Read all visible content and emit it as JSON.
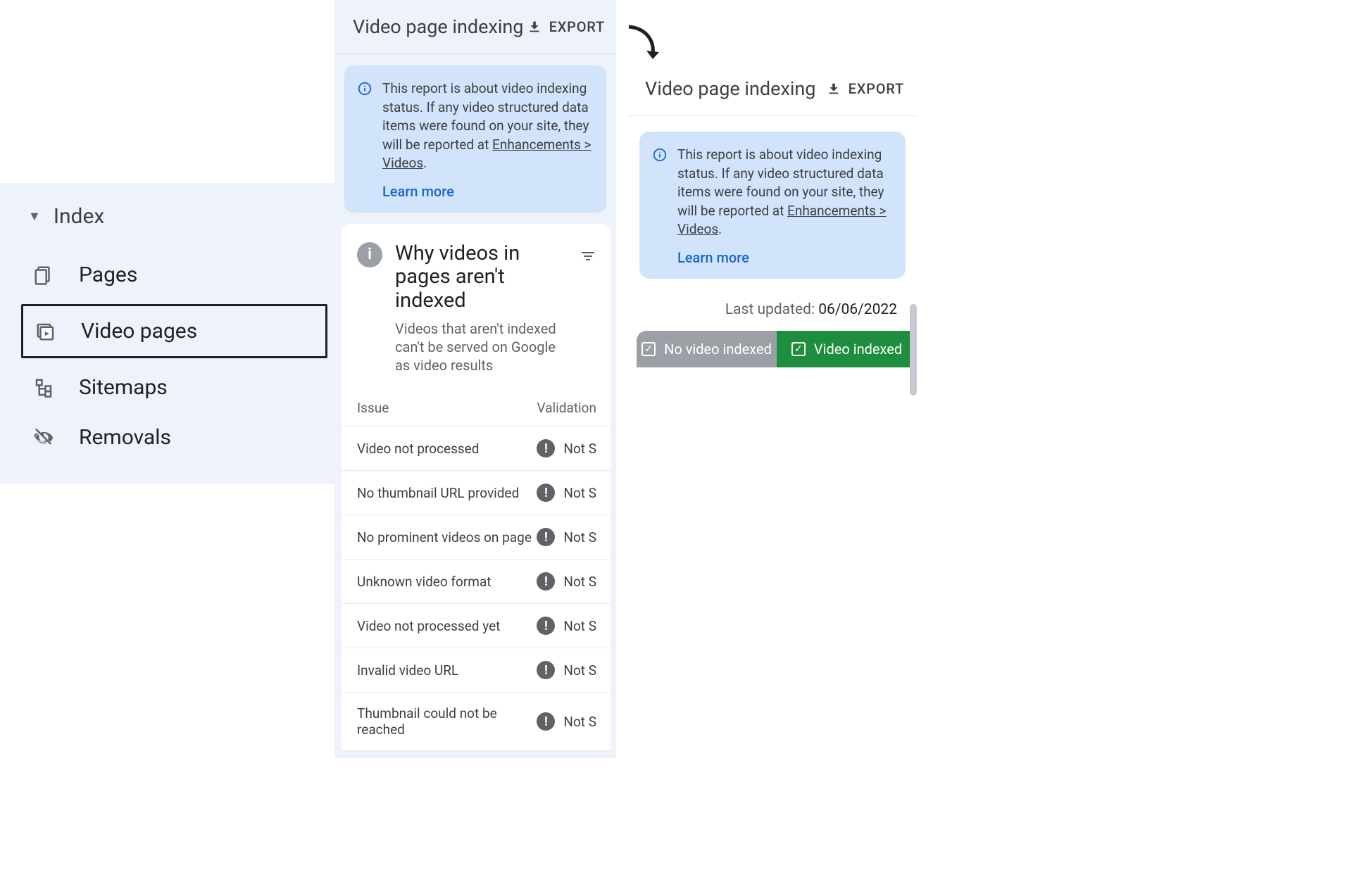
{
  "sidebar": {
    "group_label": "Index",
    "items": [
      {
        "label": "Pages"
      },
      {
        "label": "Video pages"
      },
      {
        "label": "Sitemaps"
      },
      {
        "label": "Removals"
      }
    ]
  },
  "mid": {
    "title": "Video page indexing",
    "export_label": "EXPORT",
    "info_text_a": "This report is about video indexing status. If any video structured data items were found on your site, they will be reported at ",
    "info_link": "Enhancements > Videos",
    "info_text_b": ".",
    "learn_more": "Learn more",
    "card_title": "Why videos in pages aren't indexed",
    "card_sub": "Videos that aren't indexed can't be served on Google as video results",
    "col_issue": "Issue",
    "col_valid": "Validation",
    "rows": [
      {
        "label": "Video not processed",
        "status": "Not S"
      },
      {
        "label": "No thumbnail URL provided",
        "status": "Not S"
      },
      {
        "label": "No prominent videos on page",
        "status": "Not S"
      },
      {
        "label": "Unknown video format",
        "status": "Not S"
      },
      {
        "label": "Video not processed yet",
        "status": "Not S"
      },
      {
        "label": "Invalid video URL",
        "status": "Not S"
      },
      {
        "label": "Thumbnail could not be reached",
        "status": "Not S"
      }
    ]
  },
  "right": {
    "title": "Video page indexing",
    "export_label": "EXPORT",
    "info_text_a": "This report is about video indexing status. If any video structured data items were found on your site, they will be reported at ",
    "info_link": "Enhancements > Videos",
    "info_text_b": ".",
    "learn_more": "Learn more",
    "lastupd_label": "Last updated: ",
    "lastupd_value": "06/06/2022",
    "tab_no": "No video indexed",
    "tab_yes": "Video indexed"
  }
}
